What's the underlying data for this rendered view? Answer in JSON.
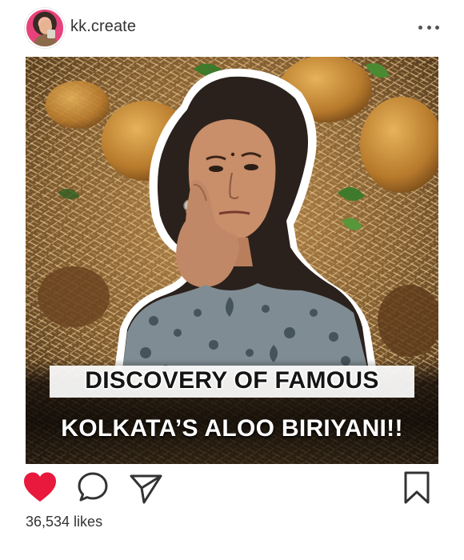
{
  "post": {
    "username": "kk.create",
    "caption_line1": "DISCOVERY OF FAMOUS",
    "caption_line2": "KOLKATA’S ALOO BIRIYANI!!",
    "likes_text": "36,534 likes"
  },
  "icons": {
    "more": "more-options-icon",
    "like": "heart-filled-icon",
    "comment": "comment-bubble-icon",
    "share": "paper-plane-icon",
    "save": "bookmark-icon"
  },
  "colors": {
    "like_red": "#e8193c",
    "text": "#262626",
    "icon_stroke": "#333333"
  }
}
